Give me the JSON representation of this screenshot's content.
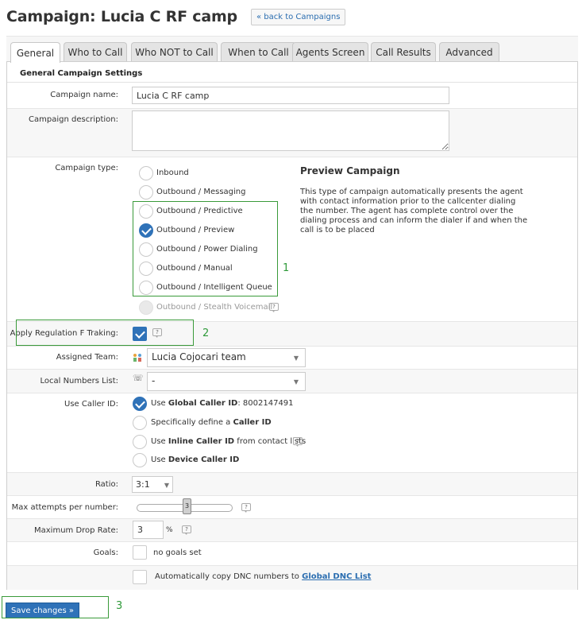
{
  "header": {
    "title": "Campaign: Lucia C RF camp",
    "back_label": "« back to Campaigns"
  },
  "tabs": [
    {
      "label": "General",
      "active": true
    },
    {
      "label": "Who to Call"
    },
    {
      "label": "Who NOT to Call"
    },
    {
      "label": "When to Call"
    },
    {
      "label": "Agents Screen"
    },
    {
      "label": "Call Results"
    },
    {
      "label": "Advanced"
    }
  ],
  "section_title": "General Campaign Settings",
  "fields": {
    "name_label": "Campaign name:",
    "name_value": "Lucia C RF camp",
    "description_label": "Campaign description:",
    "description_value": "",
    "type_label": "Campaign type:",
    "type_options": [
      {
        "label": "Inbound",
        "selected": false
      },
      {
        "label": "Outbound / Messaging",
        "selected": false
      },
      {
        "label": "Outbound / Predictive",
        "selected": false
      },
      {
        "label": "Outbound / Preview",
        "selected": true
      },
      {
        "label": "Outbound / Power Dialing",
        "selected": false
      },
      {
        "label": "Outbound / Manual",
        "selected": false
      },
      {
        "label": "Outbound / Intelligent Queue",
        "selected": false
      },
      {
        "label": "Outbound / Stealth Voicemail",
        "selected": false,
        "disabled": true
      }
    ],
    "preview_title": "Preview Campaign",
    "preview_desc": "This type of campaign automatically presents the agent with contact information prior to the callcenter dialing the number. The agent has complete control over the dialing process and can inform the dialer if and when the call is to be placed",
    "reg_label": "Apply Regulation F Traking:",
    "reg_checked": true,
    "team_label": "Assigned Team:",
    "team_value": "Lucia Cojocari team",
    "local_label": "Local Numbers List:",
    "local_value": "-",
    "callerid_label": "Use Caller ID:",
    "callerid_opt1_pre": "Use ",
    "callerid_opt1_bold": "Global Caller ID",
    "callerid_opt1_post": ": 8002147491",
    "callerid_opt2_pre": "Specifically define a ",
    "callerid_opt2_bold": "Caller ID",
    "callerid_opt3_pre": "Use ",
    "callerid_opt3_bold": "Inline Caller ID",
    "callerid_opt3_post": " from contact lists",
    "callerid_opt4_pre": "Use ",
    "callerid_opt4_bold": "Device Caller ID",
    "ratio_label": "Ratio:",
    "ratio_value": "3:1",
    "attempts_label": "Max attempts per number:",
    "attempts_value": "3",
    "drop_label": "Maximum Drop Rate:",
    "drop_value": "3",
    "drop_unit": "%",
    "goals_label": "Goals:",
    "goals_value": "no goals set",
    "dnc_pre": "Automatically copy DNC numbers to ",
    "dnc_link": "Global DNC List"
  },
  "annotations": [
    "1",
    "2",
    "3"
  ],
  "save_label": "Save changes »",
  "colors": {
    "accent": "#2f72b8",
    "annotation": "#3a9a3a"
  }
}
